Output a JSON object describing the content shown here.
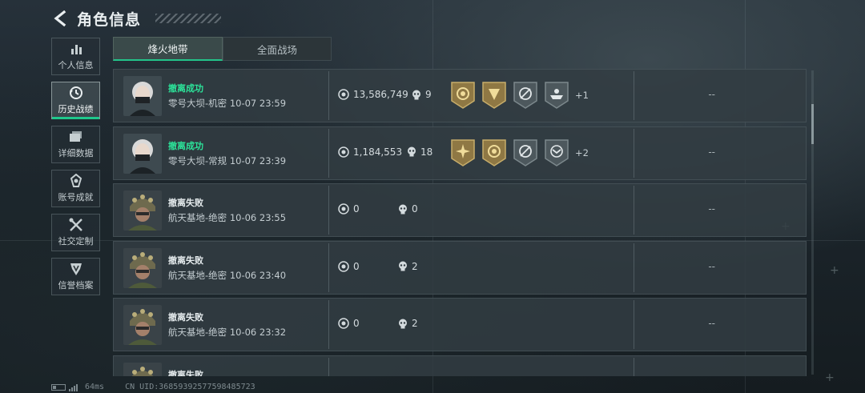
{
  "header": {
    "title": "角色信息"
  },
  "sidebar": {
    "items": [
      {
        "label": "个人信息",
        "icon": "bar-chart-icon"
      },
      {
        "label": "历史战绩",
        "icon": "history-clock-icon",
        "active": true
      },
      {
        "label": "详细数据",
        "icon": "stacked-cards-icon"
      },
      {
        "label": "账号成就",
        "icon": "achievement-icon"
      },
      {
        "label": "社交定制",
        "icon": "tools-icon"
      },
      {
        "label": "信誉档案",
        "icon": "shield-emblem-icon"
      }
    ]
  },
  "tabs": [
    {
      "label": "烽火地带",
      "active": true
    },
    {
      "label": "全面战场",
      "active": false
    }
  ],
  "matches": [
    {
      "result": "撤离成功",
      "status": "success",
      "map": "零号大坝-机密",
      "time": "10-07 23:59",
      "value": "13,586,749",
      "kills": "9",
      "badges": [
        "gold-medal-icon",
        "gold-crest-icon",
        "gray-target-icon",
        "gray-boat-icon"
      ],
      "extra": "+1",
      "dash": "--",
      "avatar": "female-operator-avatar"
    },
    {
      "result": "撤离成功",
      "status": "success",
      "map": "零号大坝-常规",
      "time": "10-07 23:39",
      "value": "1,184,553",
      "kills": "18",
      "badges": [
        "gold-sun-icon",
        "gold-medal-icon",
        "gray-target-icon",
        "gray-eagle-icon"
      ],
      "extra": "+2",
      "dash": "--",
      "avatar": "female-operator-avatar"
    },
    {
      "result": "撤离失败",
      "status": "fail",
      "map": "航天基地-绝密",
      "time": "10-06 23:55",
      "value": "0",
      "kills": "0",
      "badges": [],
      "extra": "",
      "dash": "--",
      "avatar": "helmet-operator-avatar"
    },
    {
      "result": "撤离失败",
      "status": "fail",
      "map": "航天基地-绝密",
      "time": "10-06 23:40",
      "value": "0",
      "kills": "2",
      "badges": [],
      "extra": "",
      "dash": "--",
      "avatar": "helmet-operator-avatar"
    },
    {
      "result": "撤离失败",
      "status": "fail",
      "map": "航天基地-绝密",
      "time": "10-06 23:32",
      "value": "0",
      "kills": "2",
      "badges": [],
      "extra": "",
      "dash": "--",
      "avatar": "helmet-operator-avatar"
    },
    {
      "result": "撤离失败",
      "status": "fail",
      "map": "",
      "time": "",
      "value": "",
      "kills": "",
      "badges": [],
      "extra": "",
      "dash": "",
      "avatar": "helmet-operator-avatar"
    }
  ],
  "status_bar": {
    "ping": "64ms",
    "uid": "CN UID:3685939257759848572​3"
  },
  "colors": {
    "accent": "#23c48a",
    "success": "#2ce49a",
    "badge_gold": "#b89a52",
    "badge_gray": "#6f7b80"
  }
}
